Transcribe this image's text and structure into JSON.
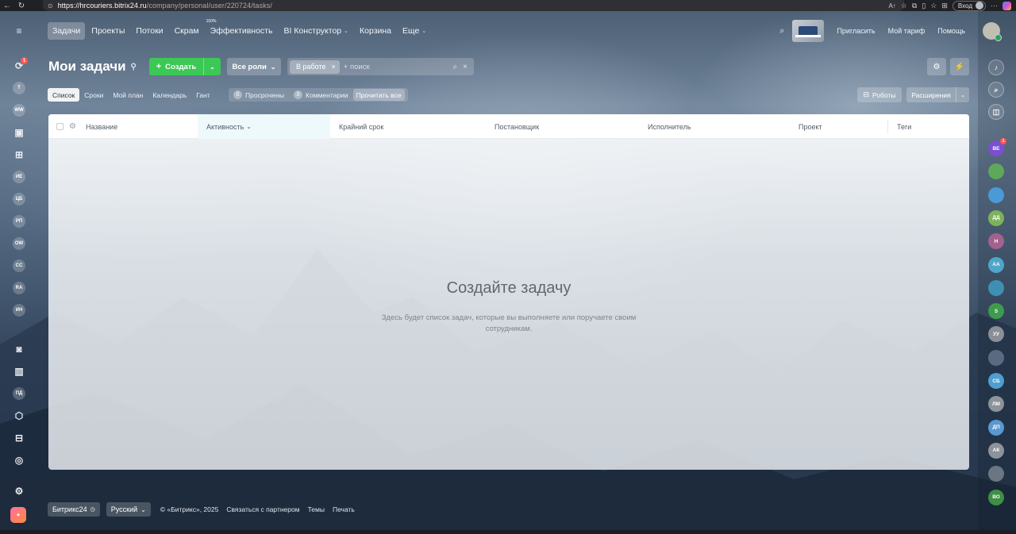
{
  "browser": {
    "url_host": "https://hrcouriers.bitrix24.ru",
    "url_path": "/company/personal/user/220724/tasks/",
    "login_label": "Вход"
  },
  "left_bar": {
    "notifications_badge": "1",
    "avatars": [
      "T",
      "WW",
      "ИЕ",
      "ЦБ",
      "РП",
      "OW",
      "CC",
      "RA",
      "ИН"
    ],
    "tool_icons": [
      "ПД"
    ]
  },
  "topnav": {
    "items": [
      {
        "label": "Задачи",
        "active": true
      },
      {
        "label": "Проекты"
      },
      {
        "label": "Потоки"
      },
      {
        "label": "Скрам"
      },
      {
        "label": "Эффективность",
        "sup": "100%"
      },
      {
        "label": "BI Конструктор",
        "caret": true
      },
      {
        "label": "Корзина"
      },
      {
        "label": "Еще",
        "caret": true
      }
    ],
    "right_links": {
      "invite": "Пригласить",
      "tariff": "Мой тариф",
      "help": "Помощь"
    }
  },
  "header": {
    "title": "Мои задачи",
    "create_label": "Создать",
    "roles_label": "Все роли",
    "filter_chip": "В работе",
    "search_placeholder": "+ поиск"
  },
  "toolbar": {
    "view_tabs": [
      "Список",
      "Сроки",
      "Мой план",
      "Календарь",
      "Гант"
    ],
    "active_tab": "Список",
    "counters": [
      {
        "count": "0",
        "label": "Просрочены"
      },
      {
        "count": "0",
        "label": "Комментарии"
      }
    ],
    "read_all": "Прочитать все",
    "robots": "Роботы",
    "extensions": "Расширения"
  },
  "grid": {
    "columns": [
      "Название",
      "Активность",
      "Крайний срок",
      "Постановщик",
      "Исполнитель",
      "Проект",
      "Теги"
    ],
    "sorted_column": "Активность",
    "empty_title": "Создайте задачу",
    "empty_text": "Здесь будет список задач, которые вы выполняете или поручаете своим сотрудникам."
  },
  "footer": {
    "brand": "Битрикс24",
    "language": "Русский",
    "copyright": "© «Битрикс», 2025",
    "links": [
      "Связаться с партнером",
      "Темы",
      "Печать"
    ]
  },
  "right_bar": {
    "chat_badge": "1",
    "avatars": [
      {
        "initials": "ВЕ",
        "color": "#7b4fcf"
      },
      {
        "initials": "",
        "color": "#5ea85a"
      },
      {
        "initials": "",
        "color": "#4a9ad8"
      },
      {
        "initials": "ДД",
        "color": "#7bb35a"
      },
      {
        "initials": "Н",
        "color": "#a4618e"
      },
      {
        "initials": "АА",
        "color": "#4fa6c8"
      },
      {
        "initials": "",
        "color": "#3f8fb5"
      },
      {
        "initials": "S",
        "color": "#3e9b4e"
      },
      {
        "initials": "УУ",
        "color": "#8a8f97"
      },
      {
        "initials": "",
        "color": "#5a6a80"
      },
      {
        "initials": "СБ",
        "color": "#4e9fd0"
      },
      {
        "initials": "ЛМ",
        "color": "#8d939b"
      },
      {
        "initials": "ДП",
        "color": "#5a98d0"
      },
      {
        "initials": "АК",
        "color": "#8d939b"
      },
      {
        "initials": "",
        "color": "#6b7583"
      },
      {
        "initials": "ВО",
        "color": "#3e8f45"
      }
    ]
  }
}
